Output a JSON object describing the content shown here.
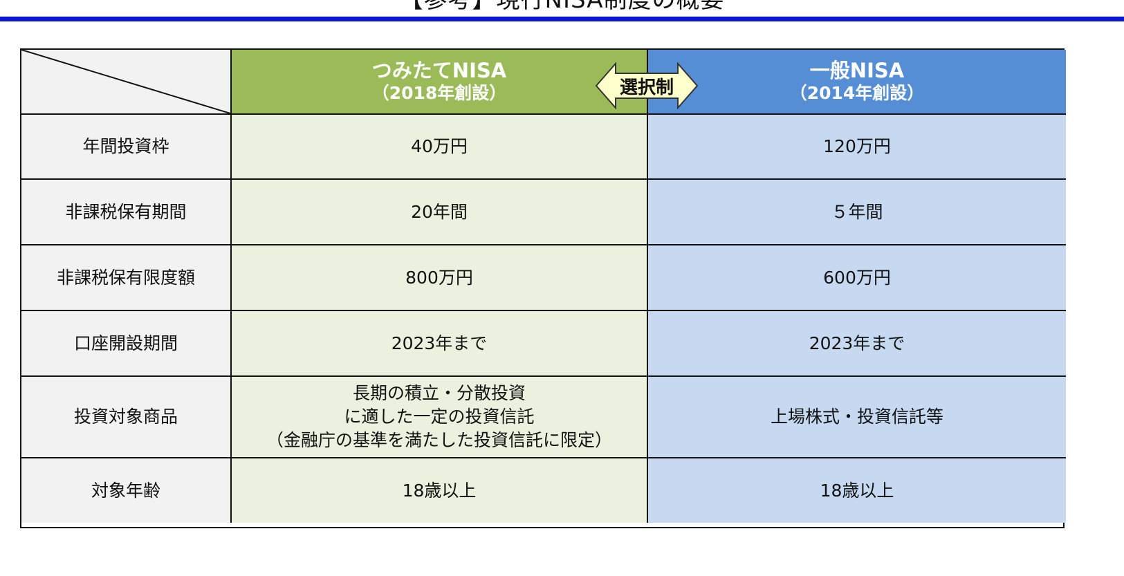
{
  "title": "【参考】現行NISA制度の概要",
  "colors": {
    "title_rule": "#0a16d6",
    "tsumitate_header": "#9bbb59",
    "tsumitate_body": "#ebf1de",
    "ippan_header": "#558ed5",
    "ippan_body": "#c6d9f1",
    "label_body": "#f2f2f2",
    "badge_fill": "#ffffcc"
  },
  "badge": {
    "label": "選択制",
    "icon": "double-arrow-icon"
  },
  "columns": [
    {
      "name": "つみたてNISA",
      "sub": "（2018年創設）"
    },
    {
      "name": "一般NISA",
      "sub": "（2014年創設）"
    }
  ],
  "rows": [
    {
      "label": "年間投資枠",
      "tsumitate": [
        "40万円"
      ],
      "ippan": [
        "120万円"
      ]
    },
    {
      "label": "非課税保有期間",
      "tsumitate": [
        "20年間"
      ],
      "ippan": [
        "５年間"
      ]
    },
    {
      "label": "非課税保有限度額",
      "tsumitate": [
        "800万円"
      ],
      "ippan": [
        "600万円"
      ]
    },
    {
      "label": "口座開設期間",
      "tsumitate": [
        "2023年まで"
      ],
      "ippan": [
        "2023年まで"
      ]
    },
    {
      "label": "投資対象商品",
      "tsumitate": [
        "長期の積立・分散投資",
        "に適した一定の投資信託",
        "（金融庁の基準を満たした投資信託に限定）"
      ],
      "ippan": [
        "上場株式・投資信託等"
      ]
    },
    {
      "label": "対象年齢",
      "tsumitate": [
        "18歳以上"
      ],
      "ippan": [
        "18歳以上"
      ]
    }
  ]
}
